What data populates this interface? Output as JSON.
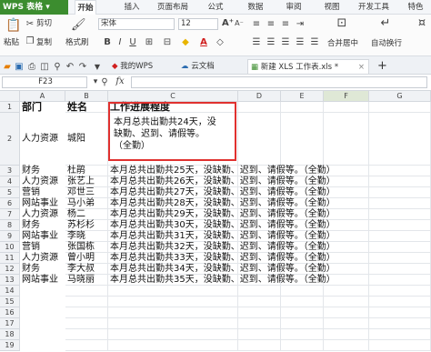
{
  "app": {
    "logo": "WPS 表格 ▾"
  },
  "menu": [
    "开始",
    "插入",
    "页面布局",
    "公式",
    "数据",
    "审阅",
    "视图",
    "开发工具",
    "特色"
  ],
  "toolbar": {
    "paste": "粘贴",
    "cut": "剪切",
    "copy": "复制",
    "format_painter": "格式刷",
    "font": "宋体",
    "size": "12",
    "merge": "合并居中",
    "wrap": "自动换行",
    "bold": "B",
    "italic": "I",
    "underline": "U"
  },
  "tabs": {
    "my_wps": "我的WPS",
    "cloud": "云文档",
    "file": "新建 XLS 工作表.xls *",
    "new": "+"
  },
  "formula": {
    "cell_ref": "F23",
    "fx": "fx",
    "value": ""
  },
  "columns": [
    "A",
    "B",
    "C",
    "D",
    "E",
    "F",
    "G"
  ],
  "rows": [
    {
      "n": "1",
      "a": "部门",
      "b": "姓名",
      "c": "工作进展程度",
      "header": true
    },
    {
      "n": "2",
      "a": "人力资源",
      "b": "城阳",
      "c_lines": [
        "本月总共出勤共24天，没",
        "缺勤、迟到、请假等。",
        "（全勤）"
      ]
    },
    {
      "n": "3",
      "a": "财务",
      "b": "杜鹃",
      "c": "本月总共出勤共25天，没缺勤、迟到、请假等。（全勤）"
    },
    {
      "n": "4",
      "a": "人力资源",
      "b": "张艺上",
      "c": "本月总共出勤共26天，没缺勤、迟到、请假等。（全勤）"
    },
    {
      "n": "5",
      "a": "营销",
      "b": "邓世三",
      "c": "本月总共出勤共27天，没缺勤、迟到、请假等。（全勤）"
    },
    {
      "n": "6",
      "a": "网站事业",
      "b": "马小弟",
      "c": "本月总共出勤共28天，没缺勤、迟到、请假等。（全勤）"
    },
    {
      "n": "7",
      "a": "人力资源",
      "b": "杨二",
      "c": "本月总共出勤共29天，没缺勤、迟到、请假等。（全勤）"
    },
    {
      "n": "8",
      "a": "财务",
      "b": "苏杉杉",
      "c": "本月总共出勤共30天，没缺勤、迟到、请假等。（全勤）"
    },
    {
      "n": "9",
      "a": "网站事业",
      "b": "李晓",
      "c": "本月总共出勤共31天，没缺勤、迟到、请假等。（全勤）"
    },
    {
      "n": "10",
      "a": "营销",
      "b": "张国栋",
      "c": "本月总共出勤共32天，没缺勤、迟到、请假等。（全勤）"
    },
    {
      "n": "11",
      "a": "人力资源",
      "b": "曾小明",
      "c": "本月总共出勤共33天，没缺勤、迟到、请假等。（全勤）"
    },
    {
      "n": "12",
      "a": "财务",
      "b": "李大叔",
      "c": "本月总共出勤共34天，没缺勤、迟到、请假等。（全勤）"
    },
    {
      "n": "13",
      "a": "网站事业",
      "b": "马晓丽",
      "c": "本月总共出勤共35天，没缺勤、迟到、请假等。（全勤）"
    },
    {
      "n": "14"
    },
    {
      "n": "15"
    },
    {
      "n": "16"
    },
    {
      "n": "17"
    },
    {
      "n": "18"
    },
    {
      "n": "19"
    }
  ],
  "colors": {
    "logo_bg": "#3c8d2f",
    "highlight": "#e0312f"
  }
}
